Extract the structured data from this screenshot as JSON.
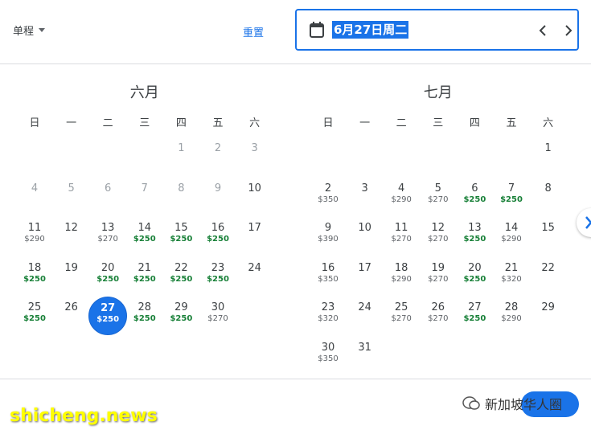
{
  "header": {
    "trip_type": "单程",
    "reset_label": "重置",
    "selected_date": "6月27日周二"
  },
  "weekdays": [
    "日",
    "一",
    "二",
    "三",
    "四",
    "五",
    "六"
  ],
  "months": [
    {
      "title": "六月",
      "offset": 4,
      "days": [
        {
          "d": "1",
          "past": true
        },
        {
          "d": "2",
          "past": true
        },
        {
          "d": "3",
          "past": true
        },
        {
          "d": "4",
          "past": true
        },
        {
          "d": "5",
          "past": true
        },
        {
          "d": "6",
          "past": true
        },
        {
          "d": "7",
          "past": true
        },
        {
          "d": "8",
          "past": true
        },
        {
          "d": "9",
          "past": true
        },
        {
          "d": "10"
        },
        {
          "d": "11",
          "p": "$290"
        },
        {
          "d": "12"
        },
        {
          "d": "13",
          "p": "$270"
        },
        {
          "d": "14",
          "p": "$250",
          "low": true
        },
        {
          "d": "15",
          "p": "$250",
          "low": true
        },
        {
          "d": "16",
          "p": "$250",
          "low": true
        },
        {
          "d": "17"
        },
        {
          "d": "18",
          "p": "$250",
          "low": true
        },
        {
          "d": "19"
        },
        {
          "d": "20",
          "p": "$250",
          "low": true
        },
        {
          "d": "21",
          "p": "$250",
          "low": true
        },
        {
          "d": "22",
          "p": "$250",
          "low": true
        },
        {
          "d": "23",
          "p": "$250",
          "low": true
        },
        {
          "d": "24"
        },
        {
          "d": "25",
          "p": "$250",
          "low": true
        },
        {
          "d": "26"
        },
        {
          "d": "27",
          "p": "$250",
          "sel": true
        },
        {
          "d": "28",
          "p": "$250",
          "low": true
        },
        {
          "d": "29",
          "p": "$250",
          "low": true
        },
        {
          "d": "30",
          "p": "$270"
        }
      ]
    },
    {
      "title": "七月",
      "offset": 6,
      "days": [
        {
          "d": "1"
        },
        {
          "d": "2",
          "p": "$350"
        },
        {
          "d": "3"
        },
        {
          "d": "4",
          "p": "$290"
        },
        {
          "d": "5",
          "p": "$270"
        },
        {
          "d": "6",
          "p": "$250",
          "low": true
        },
        {
          "d": "7",
          "p": "$250",
          "low": true
        },
        {
          "d": "8"
        },
        {
          "d": "9",
          "p": "$390"
        },
        {
          "d": "10"
        },
        {
          "d": "11",
          "p": "$270"
        },
        {
          "d": "12",
          "p": "$270"
        },
        {
          "d": "13",
          "p": "$250",
          "low": true
        },
        {
          "d": "14",
          "p": "$290"
        },
        {
          "d": "15"
        },
        {
          "d": "16",
          "p": "$350"
        },
        {
          "d": "17"
        },
        {
          "d": "18",
          "p": "$290"
        },
        {
          "d": "19",
          "p": "$270"
        },
        {
          "d": "20",
          "p": "$250",
          "low": true
        },
        {
          "d": "21",
          "p": "$320"
        },
        {
          "d": "22"
        },
        {
          "d": "23",
          "p": "$320"
        },
        {
          "d": "24"
        },
        {
          "d": "25",
          "p": "$270"
        },
        {
          "d": "26",
          "p": "$270"
        },
        {
          "d": "27",
          "p": "$250",
          "low": true
        },
        {
          "d": "28",
          "p": "$290"
        },
        {
          "d": "29"
        },
        {
          "d": "30",
          "p": "$350"
        },
        {
          "d": "31"
        }
      ]
    }
  ],
  "watermarks": {
    "left": "shicheng.news",
    "right": "新加坡华人圈"
  },
  "colors": {
    "accent": "#1a73e8",
    "low_price": "#188038"
  }
}
